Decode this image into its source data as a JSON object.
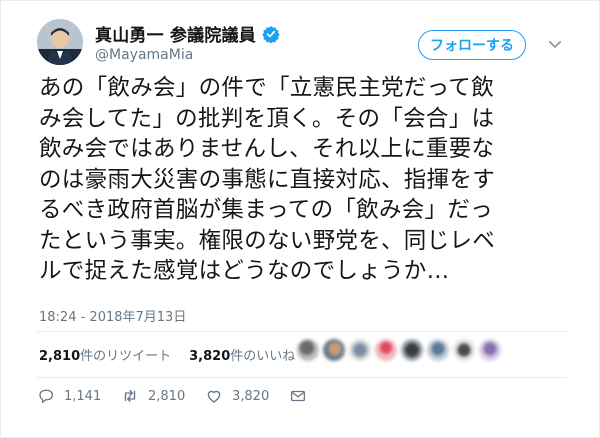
{
  "author": {
    "name": "真山勇一 参議院議員",
    "handle": "@MayamaMia"
  },
  "follow_label": "フォローする",
  "tweet_lines": [
    "あの「飲み会」の件で「立憲民主党だって飲",
    "み会してた」の批判を頂く。その「会合」は",
    "飲み会ではありませんし、それ以上に重要な",
    "のは豪雨大災害の事態に直接対応、指揮をす",
    "るべき政府首脳が集まっての「飲み会」だっ",
    "たという事実。権限のない野党を、同じレベ",
    "ルで捉えた感覚はどうなのでしょうか…"
  ],
  "timestamp": "18:24 - 2018年7月13日",
  "stats": {
    "retweets": "2,810",
    "retweets_label": "件のリツイート",
    "likes": "3,820",
    "likes_label": "件のいいね"
  },
  "actions": {
    "replies": "1,141",
    "retweets": "2,810",
    "likes": "3,820"
  },
  "colors": {
    "accent": "#1da1f2",
    "secondary_text": "#657786",
    "primary_text": "#14171a"
  }
}
